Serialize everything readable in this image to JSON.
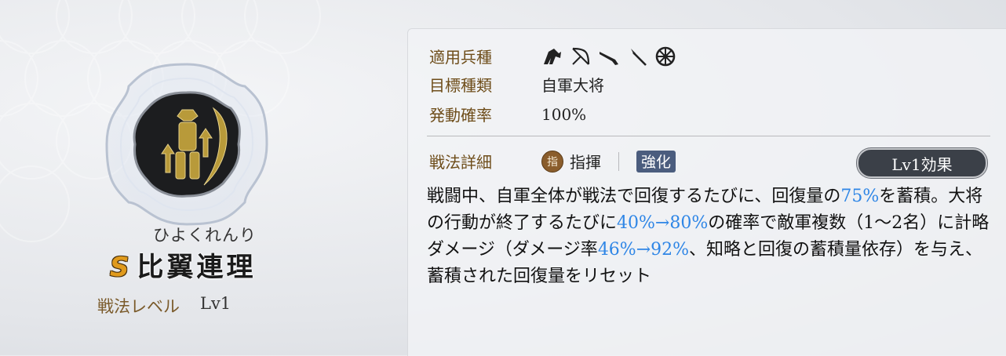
{
  "skill": {
    "reading": "ひよくれんり",
    "rank": "S",
    "name": "比翼連理",
    "level_label": "戦法レベル",
    "level_value": "Lv1",
    "emblem_icon": "command-warrior-emblem-icon"
  },
  "details": {
    "troop_label": "適用兵種",
    "troop_icons": [
      "cavalry-icon",
      "bow-icon",
      "gun-icon",
      "spear-icon",
      "wheel-icon"
    ],
    "target_label": "目標種類",
    "target_value": "自軍大将",
    "rate_label": "発動確率",
    "rate_value": "100%",
    "detail_label": "戦法詳細",
    "command_badge": "指",
    "command_text": "指揮",
    "tag_text": "強化",
    "effect_button": "Lv1効果"
  },
  "description": {
    "p1": "戦闘中、自軍全体が戦法で回復するたびに、回復量の",
    "h1": "75%",
    "p2": "を蓄積。大将の行動が終了するたびに",
    "h2": "40%→80%",
    "p3": "の確率で敵軍複数（1〜2名）に計略ダメージ（ダメージ率",
    "h3": "46%→92%",
    "p4": "、知略と回復の蓄積量依存）を与え、蓄積された回復量をリセット"
  },
  "colors": {
    "highlight": "#2f86e6",
    "label_brown": "#6e4d1a",
    "rank_gold": "#e09a1c",
    "tag_bg": "#4b5d7e"
  }
}
